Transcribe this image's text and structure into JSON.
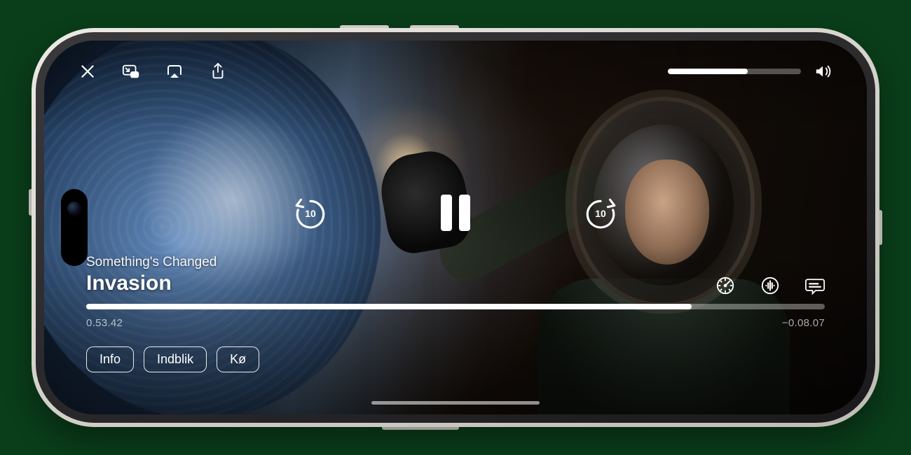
{
  "episode_title": "Something's Changed",
  "show_title": "Invasion",
  "time_elapsed": "0.53.42",
  "time_remaining": "−0.08.07",
  "progress_pct": 82,
  "volume_pct": 60,
  "skip_seconds": "10",
  "tabs": {
    "info": "Info",
    "insight": "Indblik",
    "queue": "Kø"
  },
  "icons": {
    "close": "close-icon",
    "pip": "picture-in-picture-icon",
    "airplay": "airplay-icon",
    "share": "share-icon",
    "volume": "volume-icon",
    "skip_back": "skip-back-10-icon",
    "pause": "pause-icon",
    "skip_fwd": "skip-forward-10-icon",
    "speed": "playback-speed-icon",
    "audio": "audio-track-icon",
    "subtitles": "subtitles-icon"
  }
}
